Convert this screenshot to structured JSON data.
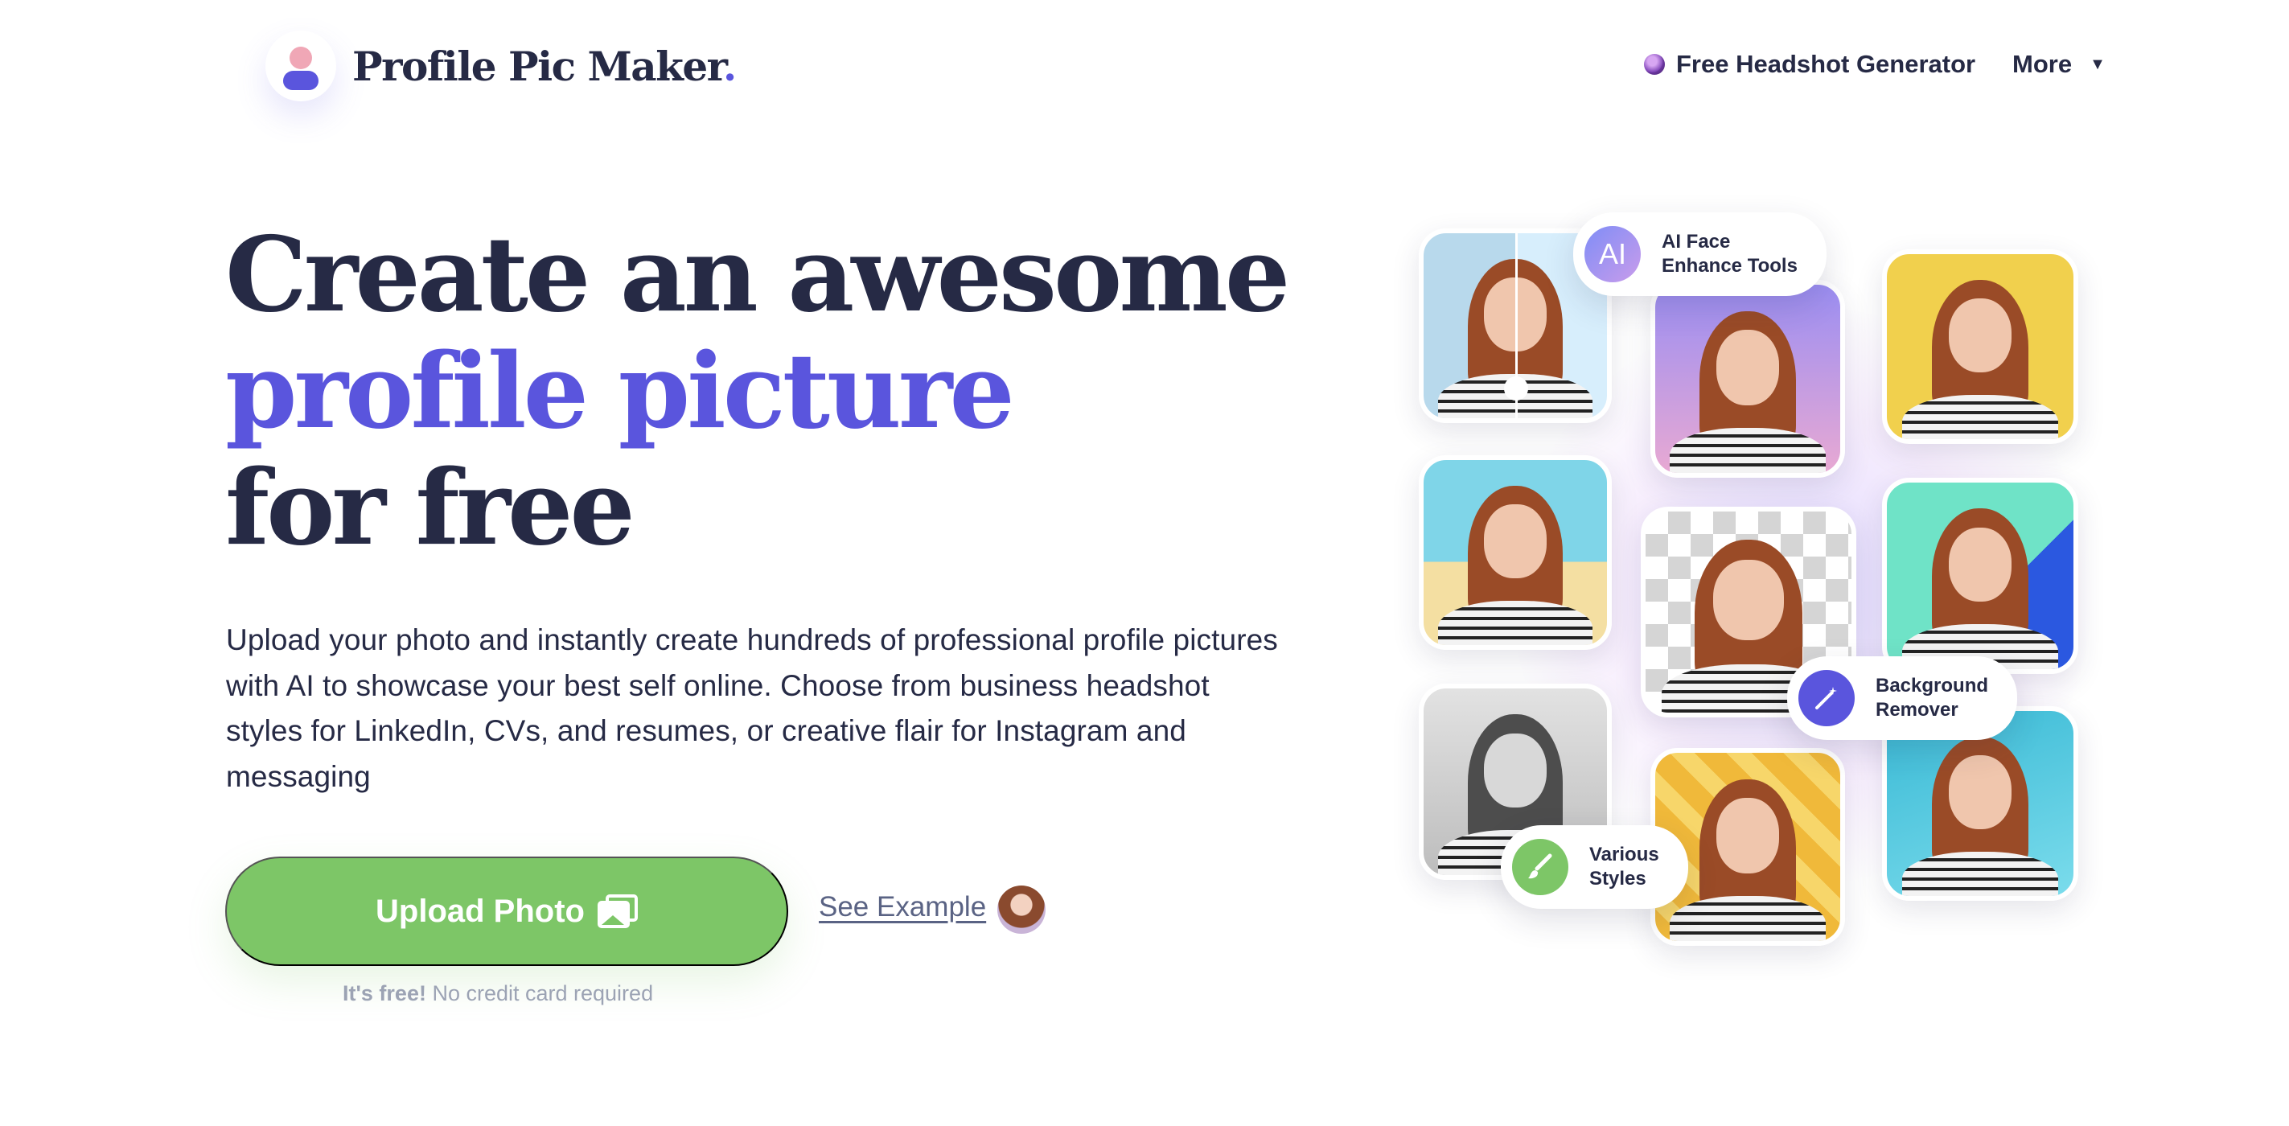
{
  "header": {
    "brand": "Profile Pic Maker",
    "brand_dot": ".",
    "nav": {
      "headshot_label": "Free Headshot Generator",
      "more_label": "More",
      "more_caret": "▼"
    }
  },
  "hero": {
    "title_line1": "Create an awesome",
    "title_line2": "profile picture",
    "title_line3": "for free",
    "description": "Upload your photo and instantly create hundreds of professional profile pictures with AI to showcase your best self online. Choose from business headshot styles for LinkedIn, CVs, and resumes, or creative flair for Instagram and messaging",
    "upload_label": "Upload Photo",
    "see_example_label": "See Example",
    "free_bold": "It's free!",
    "free_rest": " No credit card required"
  },
  "features": {
    "ai_icon": "AI",
    "ai_line1": "AI Face",
    "ai_line2": "Enhance Tools",
    "bg_line1": "Background",
    "bg_line2": "Remover",
    "styles_line1": "Various",
    "styles_line2": "Styles"
  },
  "colors": {
    "accent": "#5a55dd",
    "upload_green": "#7dc667",
    "text_dark": "#262a45"
  },
  "icons": [
    "user-logo-icon",
    "globe-icon",
    "chevron-down-icon",
    "photo-icon",
    "magic-wand-icon",
    "brush-icon"
  ]
}
